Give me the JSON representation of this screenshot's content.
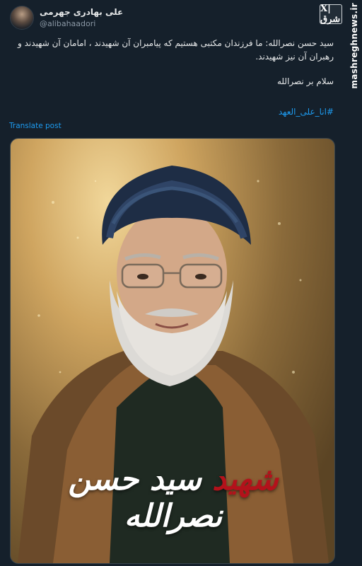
{
  "header": {
    "display_name": "علی بهادری جهرمی",
    "handle": "@alibahaadori"
  },
  "tweet": {
    "text": "سید حسن نصرالله: ما فرزندان مکتبی هستیم که پیامبران آن شهیدند ، امامان آن شهیدند و رهبران آن نیز شهیدند.",
    "salam": "سلام بر نصرالله",
    "hashtag": "#انا_علی_العهد",
    "translate_label": "Translate post"
  },
  "watermark": {
    "logo_text": "X|شرق",
    "site": "mashreghnews.ir"
  },
  "poster": {
    "caption_red": "شهید",
    "caption_white": "سید حسن نصرالله"
  },
  "colors": {
    "background": "#15202b",
    "link": "#1d9bf0",
    "secondary_text": "#8b98a5",
    "caption_red": "#b3121b"
  }
}
